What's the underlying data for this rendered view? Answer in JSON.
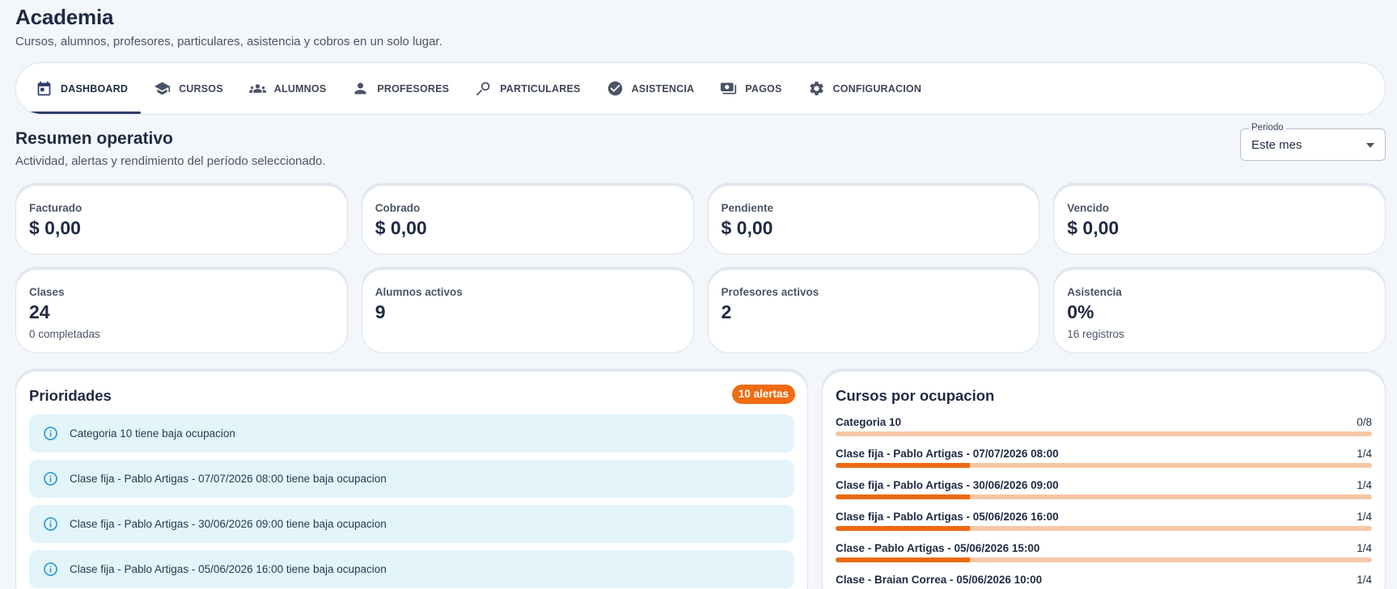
{
  "app": {
    "title": "Academia",
    "subtitle": "Cursos, alumnos, profesores, particulares, asistencia y cobros en un solo lugar."
  },
  "nav": {
    "items": [
      {
        "label": "DASHBOARD",
        "icon": "calendar-icon",
        "active": true
      },
      {
        "label": "CURSOS",
        "icon": "graduation-cap-icon",
        "active": false
      },
      {
        "label": "ALUMNOS",
        "icon": "people-icon",
        "active": false
      },
      {
        "label": "PROFESORES",
        "icon": "person-icon",
        "active": false
      },
      {
        "label": "PARTICULARES",
        "icon": "person-search-icon",
        "active": false
      },
      {
        "label": "ASISTENCIA",
        "icon": "check-circle-icon",
        "active": false
      },
      {
        "label": "PAGOS",
        "icon": "payments-icon",
        "active": false
      },
      {
        "label": "CONFIGURACION",
        "icon": "gear-icon",
        "active": false
      }
    ]
  },
  "summary": {
    "title": "Resumen operativo",
    "subtitle": "Actividad, alertas y rendimiento del período seleccionado."
  },
  "period": {
    "label": "Periodo",
    "value": "Este mes"
  },
  "kpis": {
    "facturado": {
      "label": "Facturado",
      "value": "$ 0,00"
    },
    "cobrado": {
      "label": "Cobrado",
      "value": "$ 0,00"
    },
    "pendiente": {
      "label": "Pendiente",
      "value": "$ 0,00"
    },
    "vencido": {
      "label": "Vencido",
      "value": "$ 0,00"
    },
    "clases": {
      "label": "Clases",
      "value": "24",
      "sub": "0 completadas"
    },
    "alumnos": {
      "label": "Alumnos activos",
      "value": "9"
    },
    "profesores": {
      "label": "Profesores activos",
      "value": "2"
    },
    "asistencia": {
      "label": "Asistencia",
      "value": "0%",
      "sub": "16 registros"
    }
  },
  "priorities": {
    "title": "Prioridades",
    "badge": "10 alertas",
    "alerts": [
      "Categoria 10 tiene baja ocupacion",
      "Clase fija - Pablo Artigas - 07/07/2026 08:00 tiene baja ocupacion",
      "Clase fija - Pablo Artigas - 30/06/2026 09:00 tiene baja ocupacion",
      "Clase fija - Pablo Artigas - 05/06/2026 16:00 tiene baja ocupacion"
    ]
  },
  "occupancy": {
    "title": "Cursos por ocupacion",
    "courses": [
      {
        "name": "Categoria 10",
        "count": "0/8",
        "fraction": 0
      },
      {
        "name": "Clase fija - Pablo Artigas - 07/07/2026 08:00",
        "count": "1/4",
        "fraction": 0.25
      },
      {
        "name": "Clase fija - Pablo Artigas - 30/06/2026 09:00",
        "count": "1/4",
        "fraction": 0.25
      },
      {
        "name": "Clase fija - Pablo Artigas - 05/06/2026 16:00",
        "count": "1/4",
        "fraction": 0.25
      },
      {
        "name": "Clase - Pablo Artigas - 05/06/2026 15:00",
        "count": "1/4",
        "fraction": 0.25
      },
      {
        "name": "Clase - Braian Correa - 05/06/2026 10:00",
        "count": "1/4",
        "fraction": 0.25
      }
    ]
  },
  "colors": {
    "accent": "#ec6a12",
    "bar_track": "#f6c7a5",
    "alert_bg": "#e3f4fb",
    "alert_icon": "#1b97c9",
    "nav_active": "#2f3d6b"
  }
}
